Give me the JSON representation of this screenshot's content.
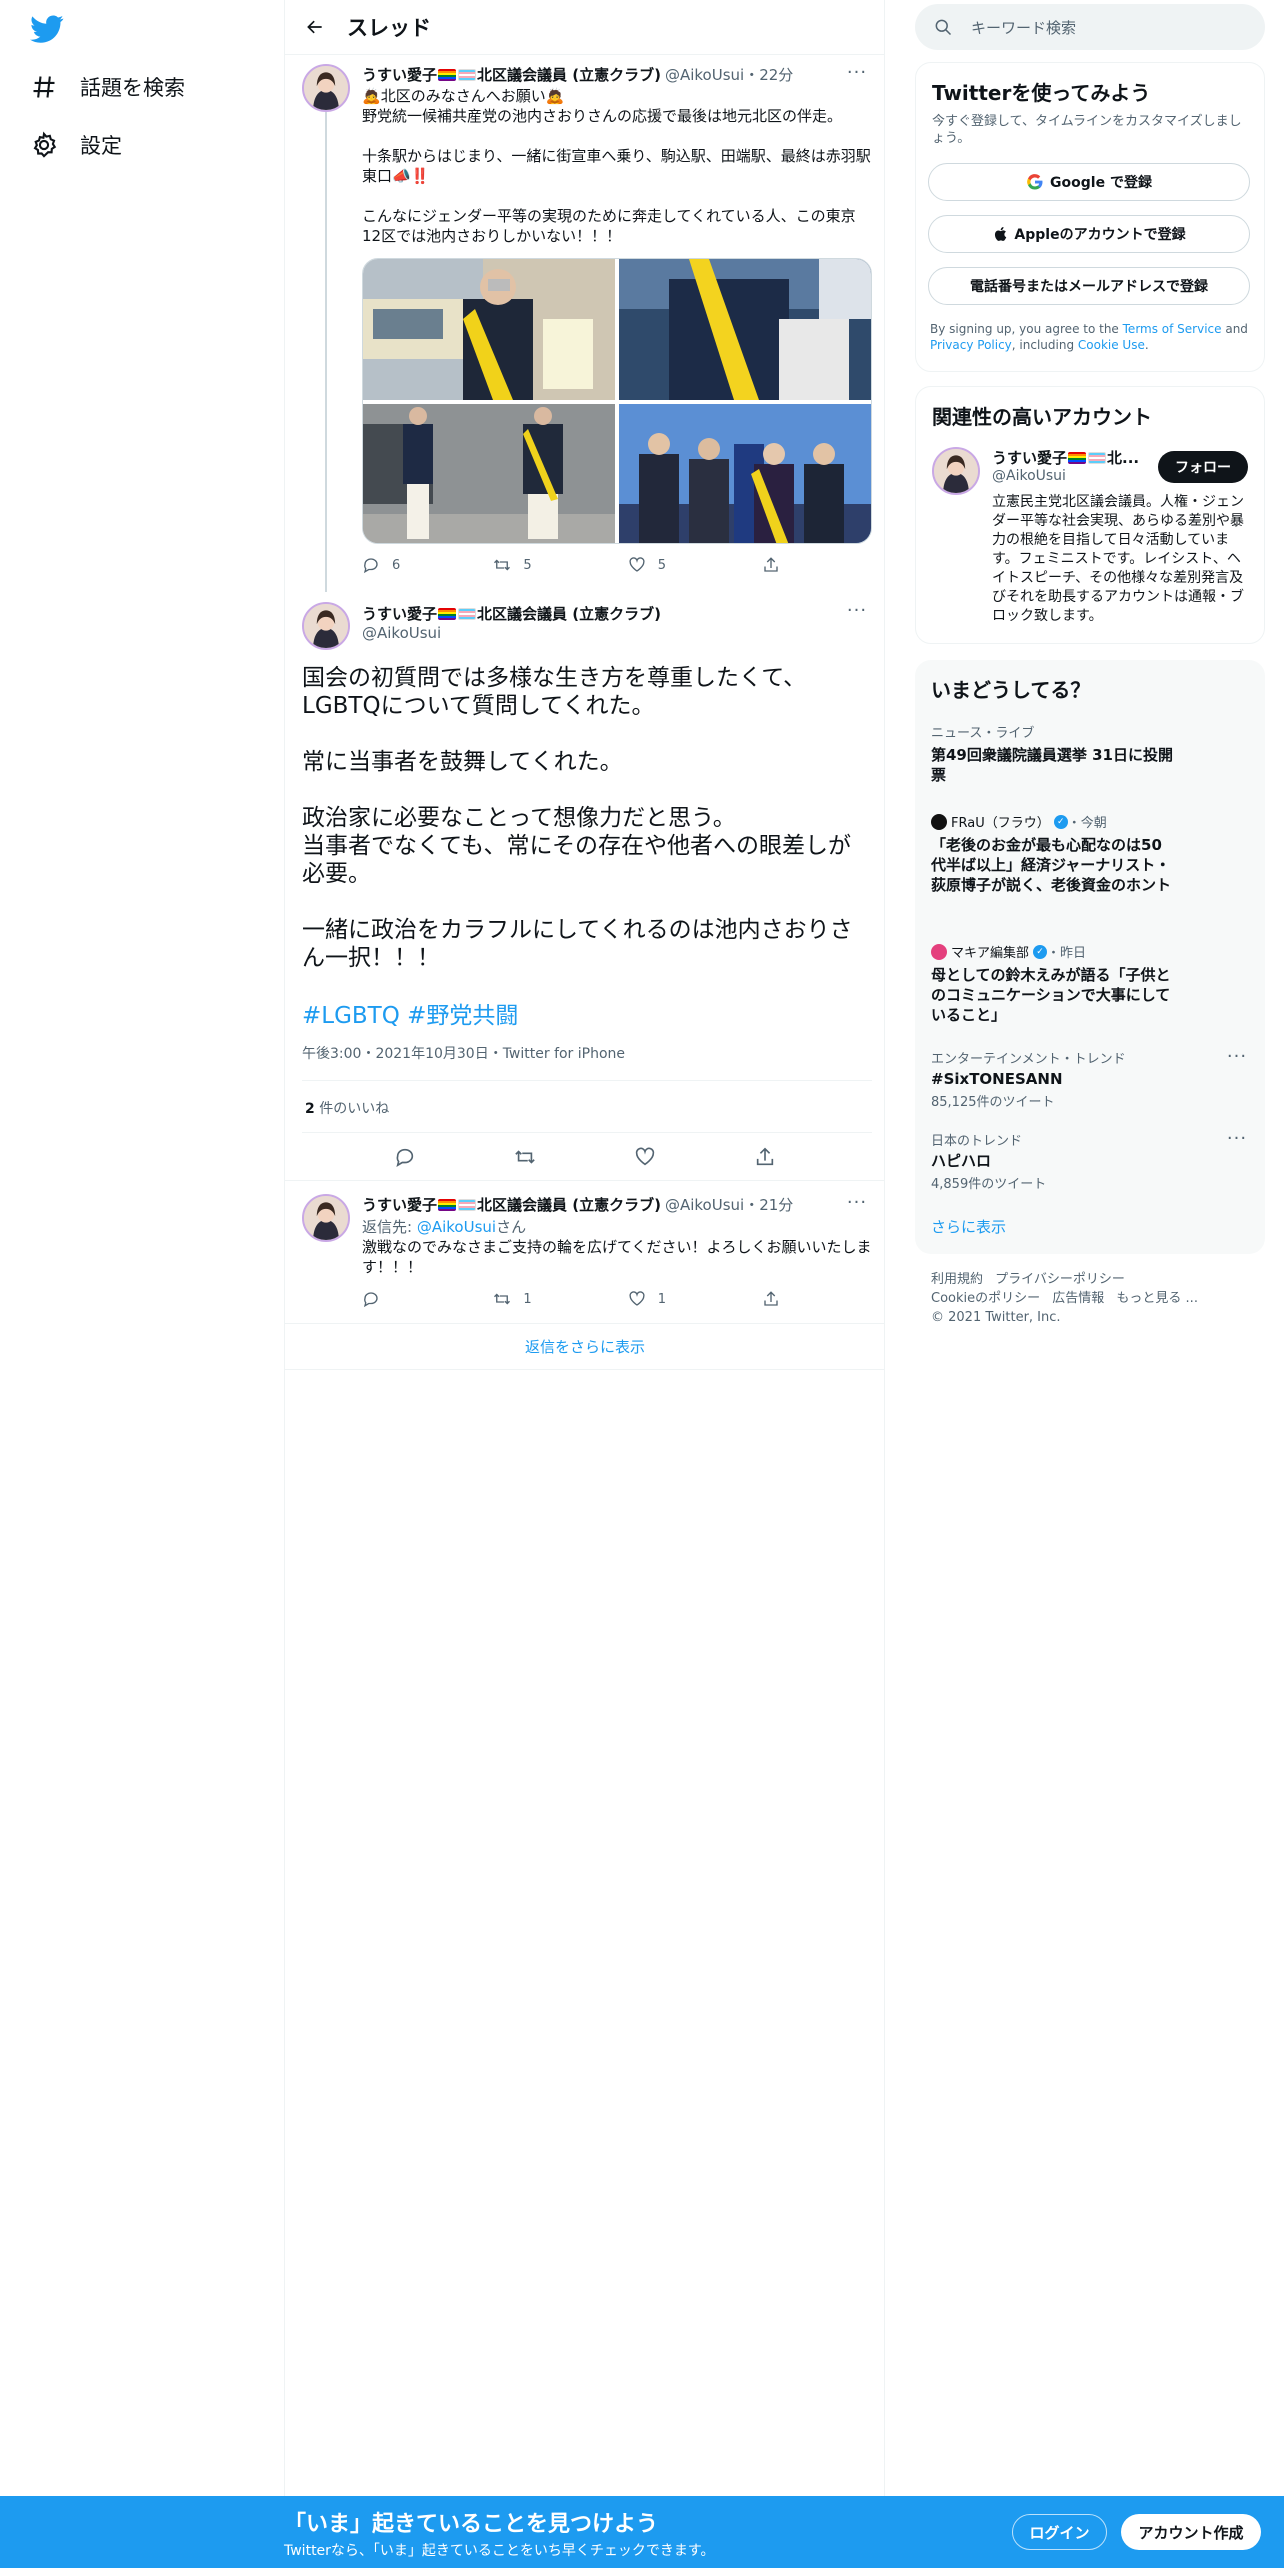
{
  "colors": {
    "accent": "#1d9bf0",
    "text": "#0f1419",
    "muted": "#536471",
    "border": "#eff3f4",
    "dark_button": "#0f1419"
  },
  "nav": {
    "logo_icon": "twitter-bird-icon",
    "explore_label": "話題を検索",
    "settings_label": "設定"
  },
  "header": {
    "title": "スレッド",
    "back_icon": "arrow-left-icon"
  },
  "author": {
    "name": "うすい愛子",
    "affiliation": "北区議会議員 (立憲クラブ)",
    "handle": "@AikoUsui"
  },
  "tweet1": {
    "time": "22分",
    "line1": "北区のみなさんへお願い",
    "body": "野党統一候補共産党の池内さおりさんの応援で最後は地元北区の伴走。\n\n十条駅からはじまり、一緒に街宣車へ乗り、駒込駅、田端駅、最終は赤羽駅東口📣‼️\n\nこんなにジェンダー平等の実現のために奔走してくれている人、この東京12区では池内さおりしかいない！！！",
    "replies": "6",
    "retweets": "5",
    "likes": "5"
  },
  "main_tweet": {
    "body": "国会の初質問では多様な生き方を尊重したくて、\nLGBTQについて質問してくれた。\n\n常に当事者を鼓舞してくれた。\n\n政治家に必要なことって想像力だと思う。\n当事者でなくても、常にその存在や他者への眼差しが必要。\n\n一緒に政治をカラフルにしてくれるのは池内さおりさん一択！！！",
    "hashtag1": "#LGBTQ",
    "hashtag2": "#野党共闘",
    "meta": "午後3:00・2021年10月30日・Twitter for iPhone",
    "likes_count": "2",
    "likes_label": "件のいいね"
  },
  "reply_tweet": {
    "time": "21分",
    "reply_to_prefix": "返信先: ",
    "reply_to_handle": "@AikoUsui",
    "reply_to_suffix": "さん",
    "body": "激戦なのでみなさまご支持の輪を広げてください！よろしくお願いいたします！！！",
    "replies": "",
    "retweets": "1",
    "likes": "1"
  },
  "show_more_replies": "返信をさらに表示",
  "right": {
    "search_placeholder": "キーワード検索",
    "signup": {
      "title": "Twitterを使ってみよう",
      "subtitle": "今すぐ登録して、タイムラインをカスタマイズしましょう。",
      "google": "Google で登録",
      "apple": "Appleのアカウントで登録",
      "phone": "電話番号またはメールアドレスで登録",
      "terms_pre": "By signing up, you agree to the ",
      "terms_link": "Terms of Service",
      "terms_mid": " and ",
      "privacy_link": "Privacy Policy",
      "terms_mid2": ", including ",
      "cookie_link": "Cookie Use",
      "terms_end": "."
    },
    "related": {
      "title": "関連性の高いアカウント",
      "name": "うすい愛子",
      "name_suffix": "北...",
      "handle": "@AikoUsui",
      "follow": "フォロー",
      "bio": "立憲民主党北区議会議員。人権・ジェンダー平等な社会実現、あらゆる差別や暴力の根絶を目指して日々活動しています。フェミニストです。レイシスト、ヘイトスピーチ、その他様々な差別発言及びそれを助長するアカウントは通報・ブロック致します。"
    },
    "trends": {
      "title": "いまどうしてる？",
      "items": [
        {
          "cat": "ニュース・ライブ",
          "title": "第49回衆議院議員選挙 31日に投開票"
        },
        {
          "source": "FRaU（フラウ）",
          "when": "・今朝",
          "title": "「老後のお金が最も心配なのは50代半ば以上」経済ジャーナリスト・荻原博子が説く、老後資金のホント"
        },
        {
          "source": "マキア編集部",
          "when": "・昨日",
          "title": "母としての鈴木えみが語る「子供とのコミュニケーションで大事にしていること」"
        },
        {
          "cat": "エンターテインメント・トレンド",
          "title": "#SixTONESANN",
          "count": "85,125件のツイート"
        },
        {
          "cat": "日本のトレンド",
          "title": "ハピハロ",
          "count": "4,859件のツイート"
        }
      ],
      "show_more": "さらに表示"
    },
    "footer": {
      "links1": [
        "利用規約",
        "プライバシーポリシー"
      ],
      "links2": [
        "Cookieのポリシー",
        "広告情報",
        "もっと見る ..."
      ],
      "copyright": "© 2021 Twitter, Inc."
    }
  },
  "bottom": {
    "title": "「いま」起きていることを見つけよう",
    "subtitle": "Twitterなら、「いま」起きていることをいち早くチェックできます。",
    "login": "ログイン",
    "signup": "アカウント作成"
  }
}
